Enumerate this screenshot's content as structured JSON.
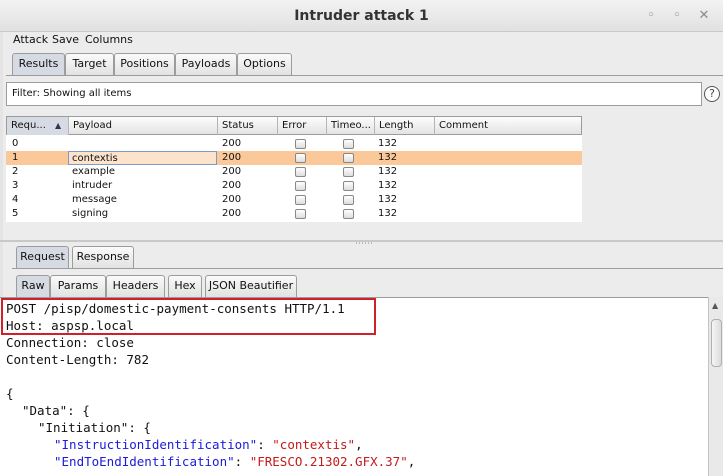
{
  "window": {
    "title": "Intruder attack 1",
    "minimize_icon": "◦",
    "restore_icon": "◦",
    "close_icon": "✕"
  },
  "menu": [
    "Attack",
    "Save",
    "Columns"
  ],
  "main_tabs": [
    "Results",
    "Target",
    "Positions",
    "Payloads",
    "Options"
  ],
  "filter": {
    "text": "Filter:  Showing all items",
    "help_icon": "?"
  },
  "table": {
    "columns": [
      "Requ...",
      "Payload",
      "Status",
      "Error",
      "Timeo...",
      "Length",
      "Comment"
    ],
    "sort_icon": "▲",
    "rows": [
      {
        "request": "0",
        "payload": "",
        "status": "200",
        "length": "132",
        "selected": false
      },
      {
        "request": "1",
        "payload": "contextis",
        "status": "200",
        "length": "132",
        "selected": true
      },
      {
        "request": "2",
        "payload": "example",
        "status": "200",
        "length": "132",
        "selected": false
      },
      {
        "request": "3",
        "payload": "intruder",
        "status": "200",
        "length": "132",
        "selected": false
      },
      {
        "request": "4",
        "payload": "message",
        "status": "200",
        "length": "132",
        "selected": false
      },
      {
        "request": "5",
        "payload": "signing",
        "status": "200",
        "length": "132",
        "selected": false
      }
    ]
  },
  "detail_tabs": [
    "Request",
    "Response"
  ],
  "view_tabs": [
    "Raw",
    "Params",
    "Headers",
    "Hex",
    "JSON Beautifier"
  ],
  "request_text": {
    "line1": "POST /pisp/domestic-payment-consents HTTP/1.1",
    "line2": "Host: aspsp.local",
    "line3": "Connection: close",
    "line4": "Content-Length: 782",
    "line6": "{",
    "line7_key": "\"Data\"",
    "line7_rest": ": {",
    "line8_key": "\"Initiation\"",
    "line8_rest": ": {",
    "line9_key": "\"InstructionIdentification\"",
    "line9_mid": ": ",
    "line9_val": "\"contextis\"",
    "line9_end": ",",
    "line10_key": "\"EndToEndIdentification\"",
    "line10_mid": ": ",
    "line10_val": "\"FRESCO.21302.GFX.37\"",
    "line10_end": ","
  },
  "colors": {
    "selected_row": "#fbc89a",
    "highlight_box": "#d0202a",
    "json_key": "#1b1bd8",
    "json_string": "#c41a1a"
  }
}
